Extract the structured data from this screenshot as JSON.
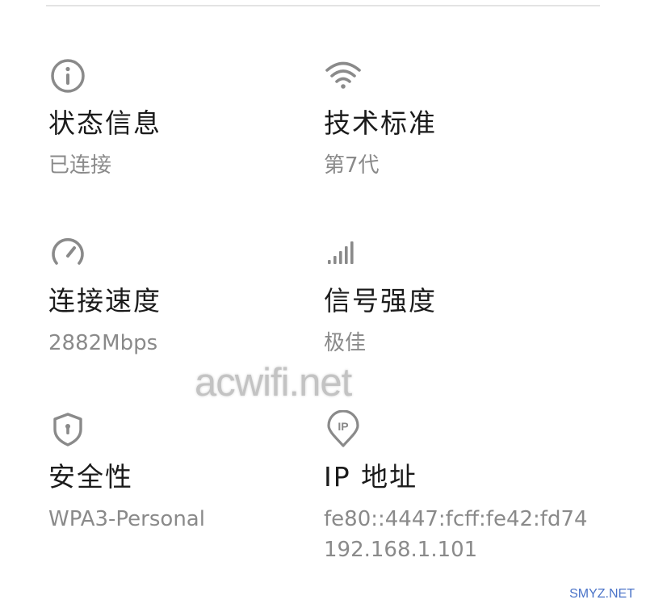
{
  "colors": {
    "icon": "#8a8a8a",
    "label": "#1b1b1b",
    "value": "#8a8a8a",
    "watermark": "#bdbdbd",
    "credit": "#4a73c8"
  },
  "items": [
    {
      "icon": "info-icon",
      "label": "状态信息",
      "value": "已连接"
    },
    {
      "icon": "wifi-icon",
      "label": "技术标准",
      "value": "第7代"
    },
    {
      "icon": "speedometer-icon",
      "label": "连接速度",
      "value": "2882Mbps"
    },
    {
      "icon": "signal-bars-icon",
      "label": "信号强度",
      "value": "极佳"
    },
    {
      "icon": "shield-icon",
      "label": "安全性",
      "value": "WPA3-Personal"
    },
    {
      "icon": "ip-location-icon",
      "label": "IP 地址",
      "values": [
        "fe80::4447:fcff:fe42:fd74",
        "192.168.1.101"
      ]
    }
  ],
  "watermark": "acwifi.net",
  "credit": "SMYZ.NET"
}
